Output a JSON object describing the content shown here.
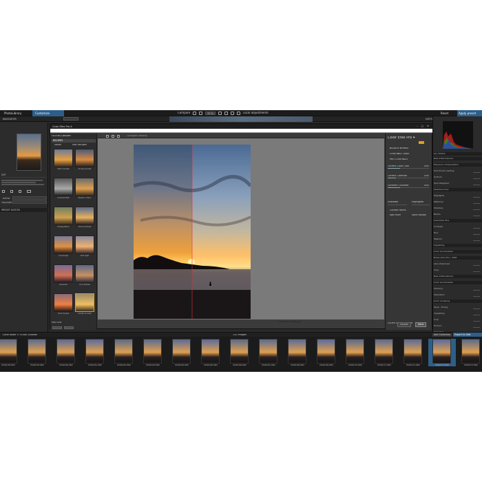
{
  "tabs": {
    "library": "PhotoLibrary",
    "customize": "Customize"
  },
  "toolbar": {
    "compare": "Compare",
    "zoom": "33 %",
    "local_adjustments": "Local adjustments",
    "reset": "Reset",
    "apply": "Apply preset"
  },
  "left_panel": {
    "section_navigator": "NAVIGATOR",
    "meta_type": "DSP",
    "section_preset_editor": "PRESET EDITOR",
    "author_label": "Author",
    "copyright_label": "Copyright"
  },
  "right_panel": {
    "section_histogram": "HISTOGRAM",
    "section_tools": "ALL TOOLS",
    "rows": [
      "Raw white balance",
      "Exposure compensation",
      "DxO Smart Lighting",
      "Uniform",
      "Spot Weighted",
      "Selective tone",
      "Highlights",
      "Midtones",
      "Shadows",
      "Blacks",
      "ClearView Plus",
      "Contrast",
      "Fine",
      "Medium",
      "Vignetting",
      "Color accentuation",
      "Noise reduction - RAW",
      "Lens sharpness",
      "Crop",
      "Raw white balance",
      "Color accentuation",
      "Vibrancy",
      "Saturation",
      "Color rendering",
      "Style - Toning",
      "Vignetting",
      "Crop",
      "Horizon",
      "Distortion"
    ]
  },
  "cep": {
    "title": "Color Efex Pro 4",
    "filters_label": "FILTERS LIBRARY",
    "recipes_label": "RECIPES",
    "left_tabs": [
      "Saved",
      "Hist Recipes"
    ],
    "history_label": "HISTORY",
    "presets": [
      {
        "label": "Warm Sunset"
      },
      {
        "label": "Cloudy Sunset"
      },
      {
        "label": "Contrast B/W"
      },
      {
        "label": "Stylizer 2 Pano"
      },
      {
        "label": "Foliage Warm"
      },
      {
        "label": "Tonal Contrast"
      },
      {
        "label": "Landscape"
      },
      {
        "label": "Soft Light"
      },
      {
        "label": "Lavender"
      },
      {
        "label": "Cool Shades"
      },
      {
        "label": "Vivid Sunset"
      },
      {
        "label": "Golden Sunset"
      }
    ],
    "photo_caption": "P1060169_Eiffel.jpg",
    "filter_name": "Color Efex Pro 4",
    "sections": [
      "BLEACH BYPASS",
      "CONTRAST ONLY",
      "PRO CONTRAST"
    ],
    "sliders": [
      {
        "label": "Correct Color Cast",
        "value": "30%",
        "fill": 0.3
      },
      {
        "label": "Correct Contrast",
        "value": "20%",
        "fill": 0.2
      },
      {
        "label": "Dynamic Contrast",
        "value": "30%",
        "fill": 0.3
      }
    ],
    "shadows": "Shadows",
    "highlights": "Highlights",
    "control_points": "Control Points",
    "add_filter": "Add Filter",
    "save_recipe": "Save Recipe",
    "loupe": "LOUPE & HISTOGRAM",
    "cancel": "Cancel",
    "save": "Save",
    "compare_label": "Compare viewing"
  },
  "filmstrip": {
    "path": "Local folder > P1060 Sunsets",
    "count": "131 images",
    "export": "Export to disk",
    "collection": "Add Collection",
    "items": [
      "P1060158.RW2",
      "P1060159.RW2",
      "P1060160.RW2",
      "P1060161.RW2",
      "P1060162.RW2",
      "P1060163.RW2",
      "P1060164.RW2",
      "P1060165.RW2",
      "P1060166.RW2",
      "P1060167.RW2",
      "P1060168.RW2",
      "P1060169.RW2",
      "P1060170.RW2",
      "P1060171.RW2",
      "P1060172.RW2",
      "P1060173.RW2",
      "P1060174.RW2"
    ]
  },
  "colors": {
    "accent": "#2d5f8a",
    "bg": "#2a2a2a"
  }
}
